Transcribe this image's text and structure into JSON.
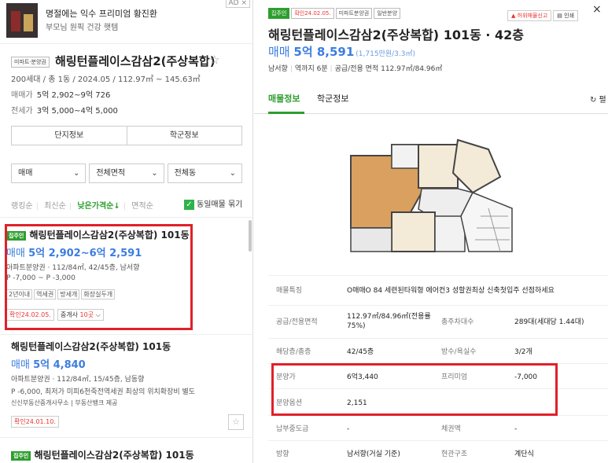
{
  "ad": {
    "title": "명절에는 익수 프리미엄 황진환",
    "subtitle": "부모님 원픽 건강 햇템",
    "badge": "AD ×"
  },
  "complex": {
    "tag": "미파트·분양권",
    "title": "해링턴플레이스감삼2(주상복합)",
    "star": "☆",
    "info": "200세대 / 총 1동 / 2024.05 / 112.97㎡ ~ 145.63㎡",
    "sale_label": "매매가",
    "sale_value": "5억 2,902~9억 726",
    "jeonse_label": "전세가",
    "jeonse_value": "3억 5,000~4억 5,000",
    "btn_info": "단지정보",
    "btn_school": "학군정보"
  },
  "filters": {
    "trade": "매매",
    "area": "전체면적",
    "dong": "전체동",
    "chev": "⌄"
  },
  "sort": {
    "items": [
      "랭킹순",
      "최신순",
      "낮은가격순↓",
      "면적순"
    ],
    "active": 2,
    "same": "동일매물 묶기",
    "check": "✓"
  },
  "listings": [
    {
      "badge": "집주인",
      "title": "해링턴플레이스감삼2(주상복합) 101동",
      "price_type": "매매",
      "price": "5억 2,902~6억 2,591",
      "spec": "아파트분양권 · 112/84㎡, 42/45층, 남서향",
      "premium": "P -7,000 ~ P -3,000",
      "tags": [
        "2년이내",
        "역세권",
        "방세개",
        "화장실두개"
      ],
      "confirm": "확인24.02.05.",
      "agent_prefix": "중개사 ",
      "agent_count": "10곳",
      "agent_suffix": " ⌵"
    },
    {
      "title": "해링턴플레이스감삼2(주상복합) 101동",
      "price_type": "매매",
      "price": "5억 4,840",
      "spec": "아파트분양권 · 112/84㎡, 15/45층, 남동향",
      "premium": "P -6,000, 최저가 미피6천죽전역세권 최상의 위치확장비 별도",
      "agency": "신신부동산중개사무소  |  부동산뱅크 제공",
      "confirm": "확인24.01.10.",
      "star": "☆"
    },
    {
      "badge": "집주인",
      "title": "해링턴플레이스감삼2(주상복합) 101동"
    }
  ],
  "detail": {
    "badges": [
      "집주인",
      "확인24.02.05.",
      "미파트분양권",
      "일반분양"
    ],
    "actions": [
      "허위매물신고",
      "인쇄"
    ],
    "close": "×",
    "title": "해링턴플레이스감삼2(주상복합) 101동 · 42층",
    "price_type": "매매",
    "price": "5억 8,591",
    "unit_price": "(1,715만원/3.3㎡)",
    "sub": [
      "남서향",
      "역까지 6분",
      "공급/전용 면적 112.97㎡/84.96㎡"
    ],
    "tabs": [
      "매물정보",
      "학군정보"
    ],
    "refresh": "↻ 펼",
    "rows": [
      {
        "h1": "매물특징",
        "v1": "O매매O 84 세련된타워형 에어컨3 성할권최상 신축첫입주 선점하세요"
      },
      {
        "h1": "공급/전용면적",
        "v1": "112.97㎡/84.96㎡(전용률75%)",
        "h2": "총주차대수",
        "v2": "289대(세대당 1.44대)"
      },
      {
        "h1": "해당층/총층",
        "v1": "42/45층",
        "h2": "방수/욕실수",
        "v2": "3/2개"
      },
      {
        "h1": "분양가",
        "v1": "6억3,440",
        "h2": "프리미엄",
        "v2": "-7,000"
      },
      {
        "h1": "분양옵션",
        "v1": "2,151"
      },
      {
        "h1": "납부중도금",
        "v1": "-",
        "h2": "체권액",
        "v2": "-"
      },
      {
        "h1": "방향",
        "v1": "남서향(거실 기준)",
        "h2": "현관구조",
        "v2": "계단식"
      }
    ]
  },
  "colors": {
    "accent": "#2e9e2e",
    "price": "#3b7de0",
    "highlight": "#e0202a"
  }
}
